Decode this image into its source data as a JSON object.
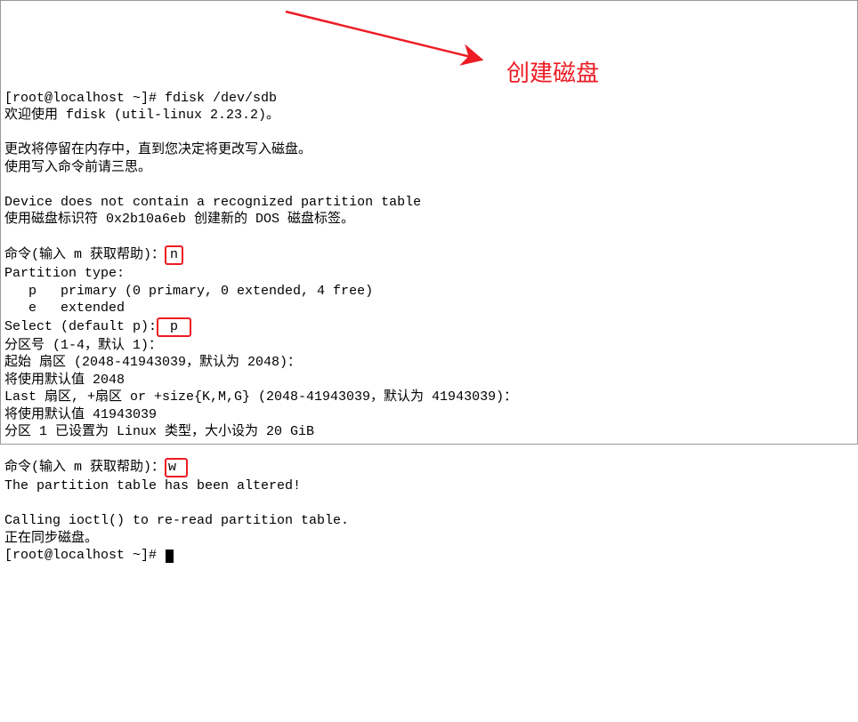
{
  "annotation": {
    "label": "创建磁盘"
  },
  "lines": {
    "l1_prompt": "[root@localhost ~]# fdisk /dev/sdb",
    "l2": "欢迎使用 fdisk (util-linux 2.23.2)。",
    "l4": "更改将停留在内存中，直到您决定将更改写入磁盘。",
    "l5": "使用写入命令前请三思。",
    "l7": "Device does not contain a recognized partition table",
    "l8": "使用磁盘标识符 0x2b10a6eb 创建新的 DOS 磁盘标签。",
    "l10_pre": "命令(输入 m 获取帮助)：",
    "l10_in": "n",
    "l11": "Partition type:",
    "l12": "   p   primary (0 primary, 0 extended, 4 free)",
    "l13": "   e   extended",
    "l14_pre": "Select (default p):",
    "l14_in": " p ",
    "l15": "分区号 (1-4，默认 1)：",
    "l16": "起始 扇区 (2048-41943039，默认为 2048)：",
    "l17": "将使用默认值 2048",
    "l18": "Last 扇区, +扇区 or +size{K,M,G} (2048-41943039，默认为 41943039)：",
    "l19": "将使用默认值 41943039",
    "l20": "分区 1 已设置为 Linux 类型，大小设为 20 GiB",
    "l22_pre": "命令(输入 m 获取帮助)：",
    "l22_in": "w ",
    "l23": "The partition table has been altered!",
    "l25": "Calling ioctl() to re-read partition table.",
    "l26": "正在同步磁盘。",
    "l27": "[root@localhost ~]# "
  },
  "colors": {
    "highlight": "#ed1c24"
  }
}
